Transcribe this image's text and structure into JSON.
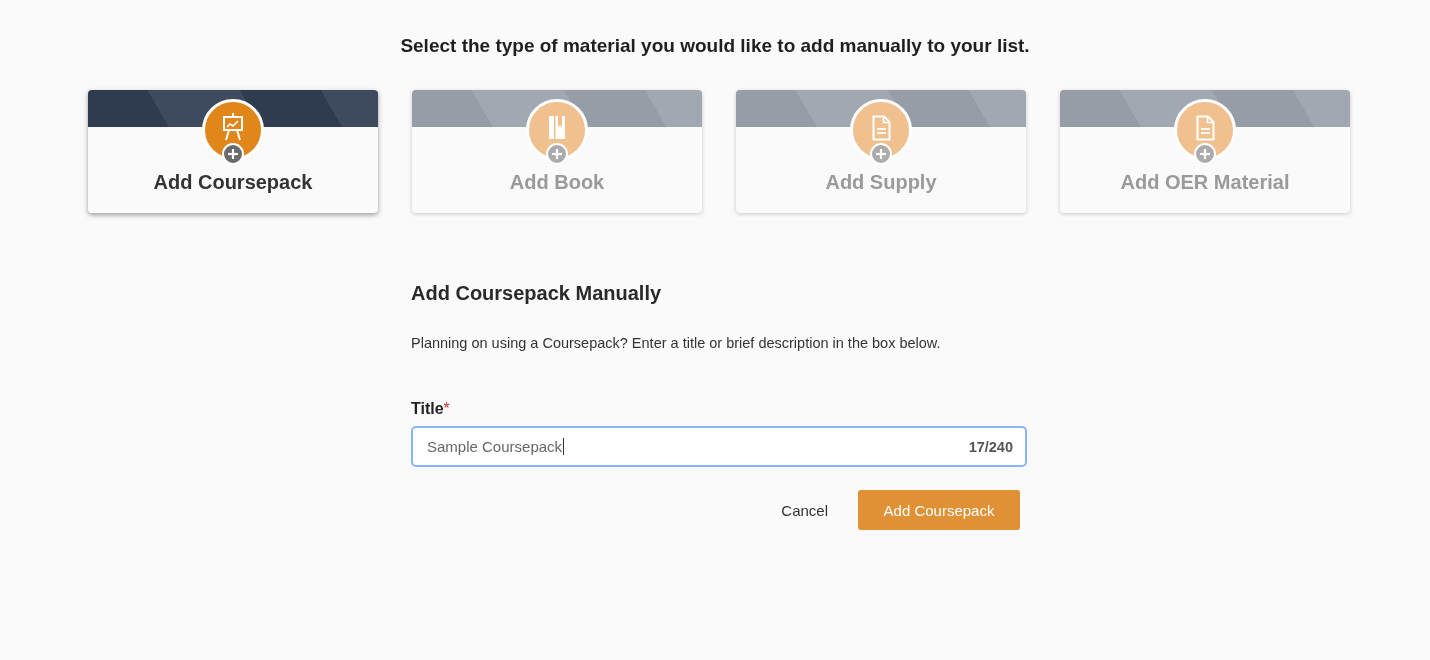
{
  "prompt": "Select the type of material you would like to add manually to your list.",
  "material_types": [
    {
      "label": "Add Coursepack",
      "kind": "coursepack",
      "selected": true
    },
    {
      "label": "Add Book",
      "kind": "book",
      "selected": false
    },
    {
      "label": "Add Supply",
      "kind": "supply",
      "selected": false
    },
    {
      "label": "Add OER Material",
      "kind": "oer",
      "selected": false
    }
  ],
  "form": {
    "heading": "Add Coursepack Manually",
    "description": "Planning on using a Coursepack? Enter a title or brief description in the box below.",
    "title_field": {
      "label": "Title",
      "required_mark": "*",
      "value": "Sample Coursepack",
      "counter": "17/240",
      "focused": true
    },
    "buttons": [
      {
        "label": "Cancel",
        "kind": "cancel"
      },
      {
        "label": "Add Coursepack",
        "kind": "submit"
      }
    ]
  }
}
